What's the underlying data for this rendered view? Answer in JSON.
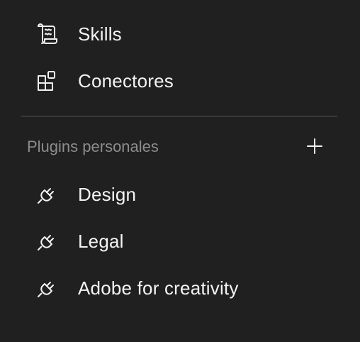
{
  "menu": {
    "items": [
      {
        "label": "Skills",
        "icon": "scroll-icon"
      },
      {
        "label": "Conectores",
        "icon": "connectors-grid-icon"
      }
    ]
  },
  "plugins": {
    "section_title": "Plugins personales",
    "add_icon": "plus-icon",
    "items": [
      {
        "label": "Design",
        "icon": "plug-icon"
      },
      {
        "label": "Legal",
        "icon": "plug-icon"
      },
      {
        "label": "Adobe for creativity",
        "icon": "plug-icon"
      }
    ]
  },
  "colors": {
    "background": "#202020",
    "text": "#f4f4f4",
    "muted_text": "#8c8c8c",
    "divider": "#393939"
  }
}
